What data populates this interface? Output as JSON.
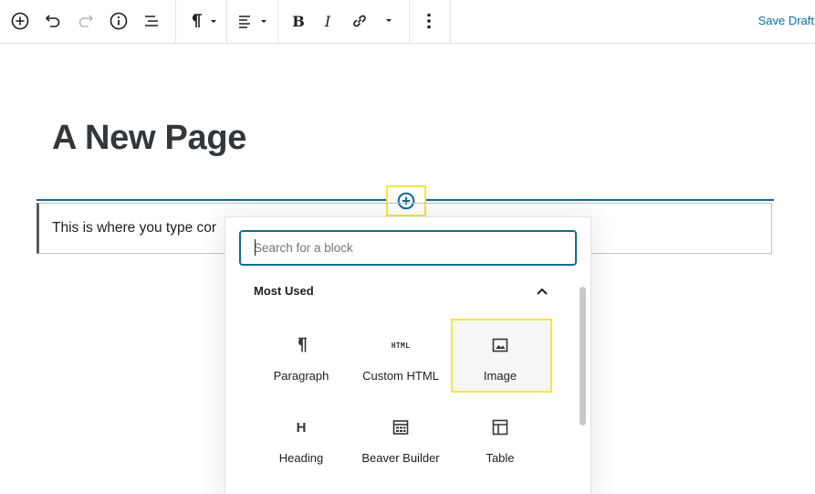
{
  "toolbar": {
    "save_label": "Save Draft",
    "icons": [
      "add-block-icon",
      "undo-icon",
      "redo-icon",
      "info-icon",
      "outline-icon",
      "paragraph-icon",
      "align-icon",
      "bold-icon",
      "italic-icon",
      "link-icon",
      "more-icon"
    ],
    "bold_glyph": "B",
    "italic_glyph": "I"
  },
  "editor": {
    "title": "A New Page",
    "paragraph_text": "This is where you type cor"
  },
  "inserter": {
    "search_placeholder": "Search for a block",
    "section_title": "Most Used",
    "blocks": [
      {
        "label": "Paragraph",
        "icon": "paragraph-icon"
      },
      {
        "label": "Custom HTML",
        "icon": "html-icon",
        "glyph": "HTML"
      },
      {
        "label": "Image",
        "icon": "image-icon"
      },
      {
        "label": "Heading",
        "icon": "heading-icon",
        "glyph": "H"
      },
      {
        "label": "Beaver Builder",
        "icon": "beaver-builder-icon"
      },
      {
        "label": "Table",
        "icon": "table-icon"
      }
    ]
  },
  "colors": {
    "accent": "#0073aa",
    "focus": "#0e6e8e",
    "highlight": "#f3e83a"
  }
}
